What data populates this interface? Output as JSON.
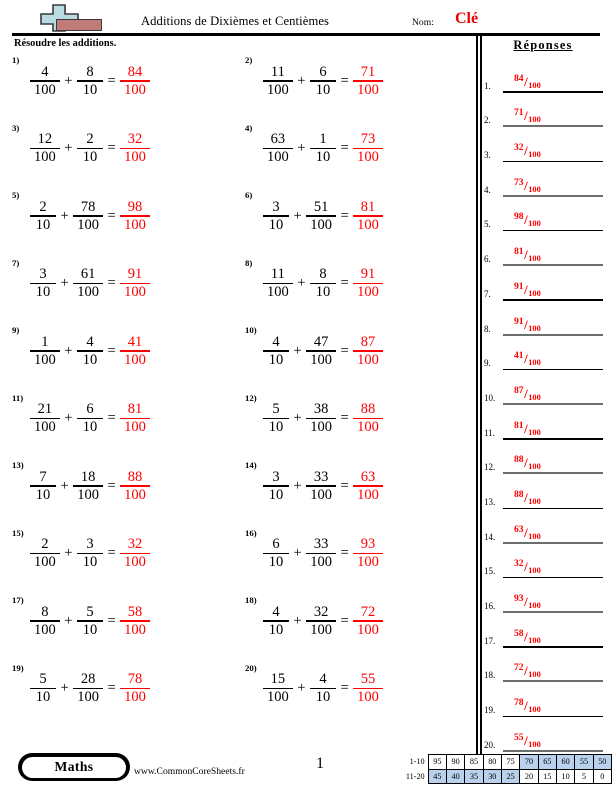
{
  "header": {
    "logo_icon": "plus-block-logo",
    "title": "Additions de Dixièmes et Centièmes",
    "name_label": "Nom:",
    "name_value": "Clé",
    "instructions": "Résoudre les additions.",
    "answers_heading": "Réponses"
  },
  "colors": {
    "answer_red": "#ff0000",
    "name_red": "#ee0000",
    "highlight_blue": "#b9d1ec",
    "logo_blue": "#b9dce2",
    "logo_red": "#c07c78",
    "rule_black": "#000000",
    "line_grey": "#6d6d6d"
  },
  "problems": [
    {
      "n": "1)",
      "a_num": "4",
      "a_den": "100",
      "op": "+",
      "b_num": "8",
      "b_den": "10",
      "eq": "=",
      "r_num": "84",
      "r_den": "100"
    },
    {
      "n": "2)",
      "a_num": "11",
      "a_den": "100",
      "op": "+",
      "b_num": "6",
      "b_den": "10",
      "eq": "=",
      "r_num": "71",
      "r_den": "100"
    },
    {
      "n": "3)",
      "a_num": "12",
      "a_den": "100",
      "op": "+",
      "b_num": "2",
      "b_den": "10",
      "eq": "=",
      "r_num": "32",
      "r_den": "100"
    },
    {
      "n": "4)",
      "a_num": "63",
      "a_den": "100",
      "op": "+",
      "b_num": "1",
      "b_den": "10",
      "eq": "=",
      "r_num": "73",
      "r_den": "100"
    },
    {
      "n": "5)",
      "a_num": "2",
      "a_den": "10",
      "op": "+",
      "b_num": "78",
      "b_den": "100",
      "eq": "=",
      "r_num": "98",
      "r_den": "100"
    },
    {
      "n": "6)",
      "a_num": "3",
      "a_den": "10",
      "op": "+",
      "b_num": "51",
      "b_den": "100",
      "eq": "=",
      "r_num": "81",
      "r_den": "100"
    },
    {
      "n": "7)",
      "a_num": "3",
      "a_den": "10",
      "op": "+",
      "b_num": "61",
      "b_den": "100",
      "eq": "=",
      "r_num": "91",
      "r_den": "100"
    },
    {
      "n": "8)",
      "a_num": "11",
      "a_den": "100",
      "op": "+",
      "b_num": "8",
      "b_den": "10",
      "eq": "=",
      "r_num": "91",
      "r_den": "100"
    },
    {
      "n": "9)",
      "a_num": "1",
      "a_den": "100",
      "op": "+",
      "b_num": "4",
      "b_den": "10",
      "eq": "=",
      "r_num": "41",
      "r_den": "100"
    },
    {
      "n": "10)",
      "a_num": "4",
      "a_den": "10",
      "op": "+",
      "b_num": "47",
      "b_den": "100",
      "eq": "=",
      "r_num": "87",
      "r_den": "100"
    },
    {
      "n": "11)",
      "a_num": "21",
      "a_den": "100",
      "op": "+",
      "b_num": "6",
      "b_den": "10",
      "eq": "=",
      "r_num": "81",
      "r_den": "100"
    },
    {
      "n": "12)",
      "a_num": "5",
      "a_den": "10",
      "op": "+",
      "b_num": "38",
      "b_den": "100",
      "eq": "=",
      "r_num": "88",
      "r_den": "100"
    },
    {
      "n": "13)",
      "a_num": "7",
      "a_den": "10",
      "op": "+",
      "b_num": "18",
      "b_den": "100",
      "eq": "=",
      "r_num": "88",
      "r_den": "100"
    },
    {
      "n": "14)",
      "a_num": "3",
      "a_den": "10",
      "op": "+",
      "b_num": "33",
      "b_den": "100",
      "eq": "=",
      "r_num": "63",
      "r_den": "100"
    },
    {
      "n": "15)",
      "a_num": "2",
      "a_den": "100",
      "op": "+",
      "b_num": "3",
      "b_den": "10",
      "eq": "=",
      "r_num": "32",
      "r_den": "100"
    },
    {
      "n": "16)",
      "a_num": "6",
      "a_den": "10",
      "op": "+",
      "b_num": "33",
      "b_den": "100",
      "eq": "=",
      "r_num": "93",
      "r_den": "100"
    },
    {
      "n": "17)",
      "a_num": "8",
      "a_den": "100",
      "op": "+",
      "b_num": "5",
      "b_den": "10",
      "eq": "=",
      "r_num": "58",
      "r_den": "100"
    },
    {
      "n": "18)",
      "a_num": "4",
      "a_den": "10",
      "op": "+",
      "b_num": "32",
      "b_den": "100",
      "eq": "=",
      "r_num": "72",
      "r_den": "100"
    },
    {
      "n": "19)",
      "a_num": "5",
      "a_den": "10",
      "op": "+",
      "b_num": "28",
      "b_den": "100",
      "eq": "=",
      "r_num": "78",
      "r_den": "100"
    },
    {
      "n": "20)",
      "a_num": "15",
      "a_den": "100",
      "op": "+",
      "b_num": "4",
      "b_den": "10",
      "eq": "=",
      "r_num": "55",
      "r_den": "100"
    }
  ],
  "answers": [
    {
      "idx": "1.",
      "num": "84",
      "den": "100"
    },
    {
      "idx": "2.",
      "num": "71",
      "den": "100"
    },
    {
      "idx": "3.",
      "num": "32",
      "den": "100"
    },
    {
      "idx": "4.",
      "num": "73",
      "den": "100"
    },
    {
      "idx": "5.",
      "num": "98",
      "den": "100"
    },
    {
      "idx": "6.",
      "num": "81",
      "den": "100"
    },
    {
      "idx": "7.",
      "num": "91",
      "den": "100"
    },
    {
      "idx": "8.",
      "num": "91",
      "den": "100"
    },
    {
      "idx": "9.",
      "num": "41",
      "den": "100"
    },
    {
      "idx": "10.",
      "num": "87",
      "den": "100"
    },
    {
      "idx": "11.",
      "num": "81",
      "den": "100"
    },
    {
      "idx": "12.",
      "num": "88",
      "den": "100"
    },
    {
      "idx": "13.",
      "num": "88",
      "den": "100"
    },
    {
      "idx": "14.",
      "num": "63",
      "den": "100"
    },
    {
      "idx": "15.",
      "num": "32",
      "den": "100"
    },
    {
      "idx": "16.",
      "num": "93",
      "den": "100"
    },
    {
      "idx": "17.",
      "num": "58",
      "den": "100"
    },
    {
      "idx": "18.",
      "num": "72",
      "den": "100"
    },
    {
      "idx": "19.",
      "num": "78",
      "den": "100"
    },
    {
      "idx": "20.",
      "num": "55",
      "den": "100"
    }
  ],
  "footer": {
    "subject_badge": "Maths",
    "site_url": "www.CommonCoreSheets.fr",
    "page_number": "1",
    "score_table": {
      "rows": [
        {
          "label": "1-10",
          "cells": [
            {
              "v": "95",
              "hl": false
            },
            {
              "v": "90",
              "hl": false
            },
            {
              "v": "85",
              "hl": false
            },
            {
              "v": "80",
              "hl": false
            },
            {
              "v": "75",
              "hl": false
            },
            {
              "v": "70",
              "hl": true
            },
            {
              "v": "65",
              "hl": true
            },
            {
              "v": "60",
              "hl": true
            },
            {
              "v": "55",
              "hl": true
            },
            {
              "v": "50",
              "hl": true
            }
          ]
        },
        {
          "label": "11-20",
          "cells": [
            {
              "v": "45",
              "hl": true
            },
            {
              "v": "40",
              "hl": true
            },
            {
              "v": "35",
              "hl": true
            },
            {
              "v": "30",
              "hl": true
            },
            {
              "v": "25",
              "hl": true
            },
            {
              "v": "20",
              "hl": false
            },
            {
              "v": "15",
              "hl": false
            },
            {
              "v": "10",
              "hl": false
            },
            {
              "v": "5",
              "hl": false
            },
            {
              "v": "0",
              "hl": false
            }
          ]
        }
      ]
    }
  }
}
